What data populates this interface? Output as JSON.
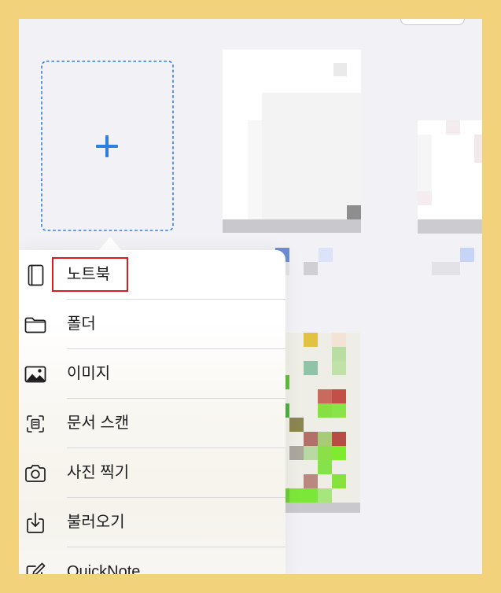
{
  "frame": {
    "color": "#F2D27A"
  },
  "canvas": {
    "background": "#F1F1F6"
  },
  "new_button": {
    "icon": "plus-icon",
    "color": "#2F7EE4"
  },
  "menu": {
    "highlight_color": "#E0191B",
    "items": [
      {
        "label": "노트북",
        "icon": "book-icon"
      },
      {
        "label": "폴더",
        "icon": "folder-icon"
      },
      {
        "label": "이미지",
        "icon": "image-icon"
      },
      {
        "label": "문서 스캔",
        "icon": "document-scan-icon"
      },
      {
        "label": "사진 찍기",
        "icon": "camera-icon"
      },
      {
        "label": "불러오기",
        "icon": "import-icon"
      },
      {
        "label": "QuickNote",
        "icon": "quicknote-icon"
      }
    ]
  }
}
